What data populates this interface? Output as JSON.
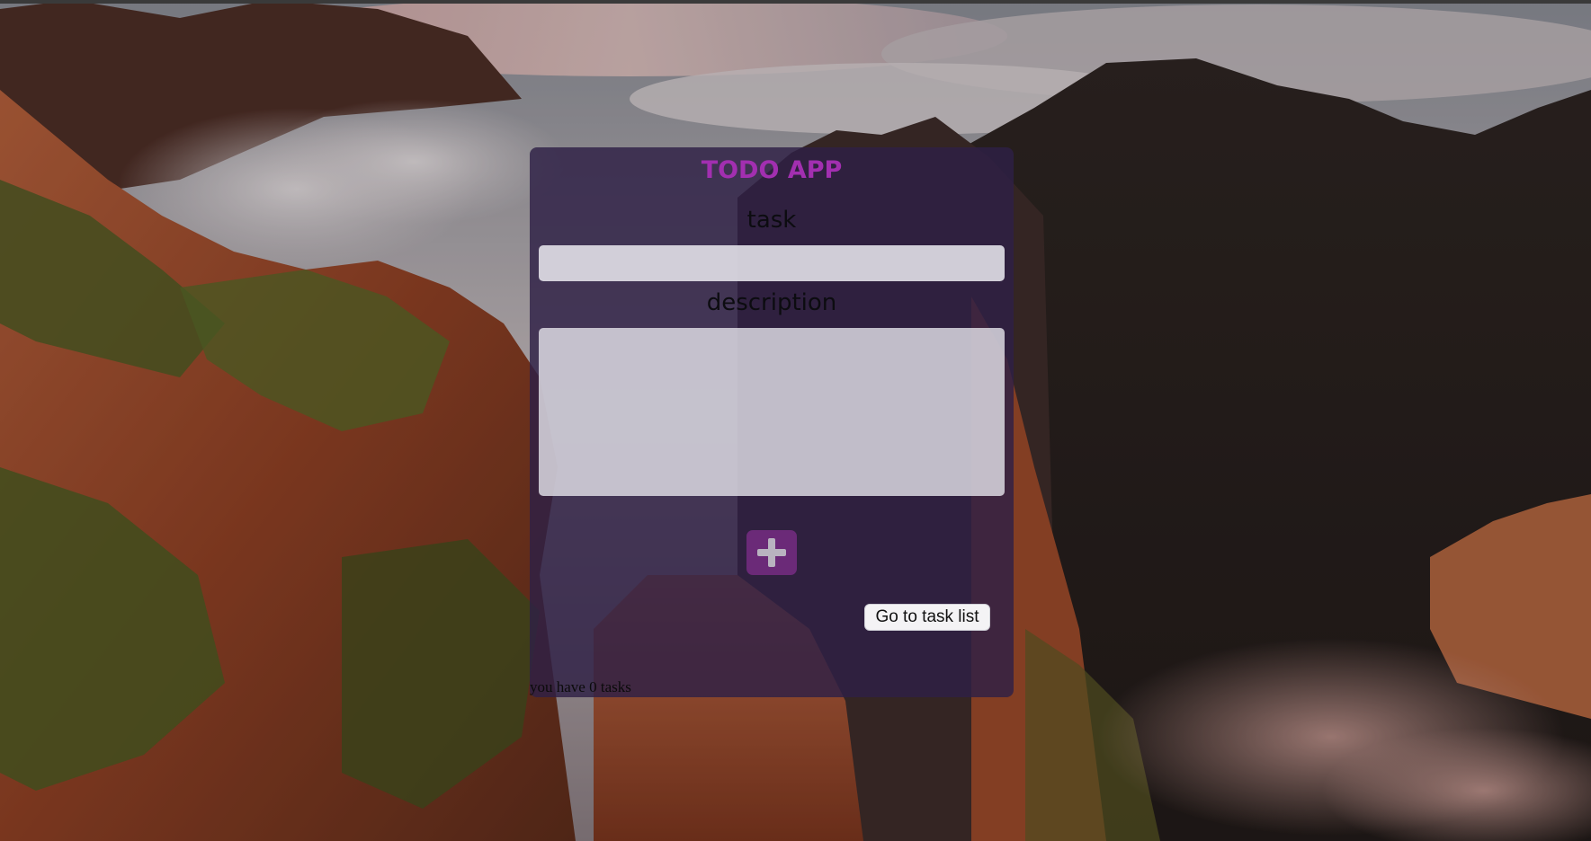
{
  "app": {
    "title": "TODO APP",
    "accent_color": "#a22fb0",
    "panel_color": "#2e2046"
  },
  "form": {
    "task_label": "task",
    "task_value": "",
    "task_placeholder": "",
    "description_label": "description",
    "description_value": "",
    "description_placeholder": "",
    "add_icon": "plus-icon",
    "add_button_color": "#6b2a78"
  },
  "nav": {
    "go_to_task_list_label": "Go to task list"
  },
  "status": {
    "task_count_text": "you have 0 tasks"
  }
}
